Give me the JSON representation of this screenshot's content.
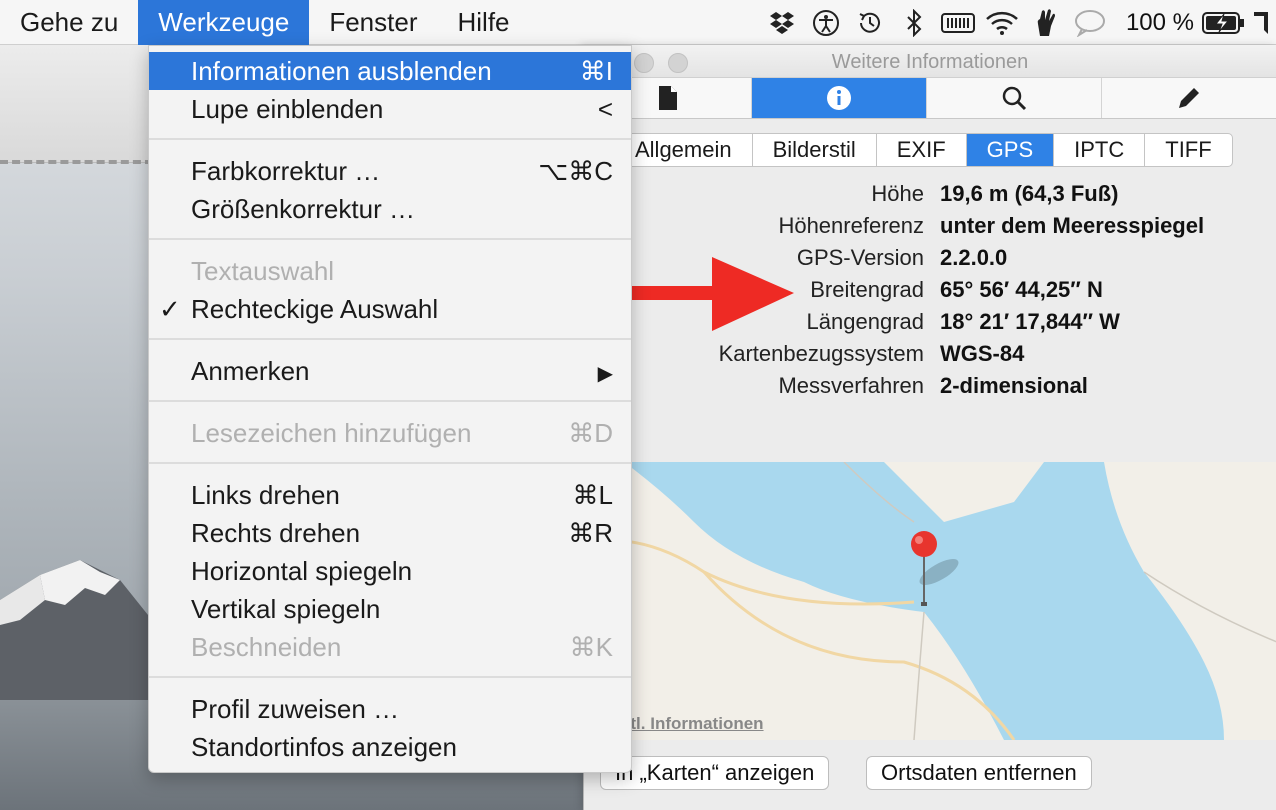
{
  "menubar": {
    "items": [
      "Gehe zu",
      "Werkzeuge",
      "Fenster",
      "Hilfe"
    ],
    "active_index": 1,
    "battery_text": "100 %"
  },
  "status_icons": [
    "dropbox-icon",
    "accessibility-icon",
    "time-machine-icon",
    "bluetooth-icon",
    "memory-icon",
    "wifi-icon",
    "hand-icon",
    "messages-icon",
    "battery-charging-icon"
  ],
  "dropdown": {
    "items": [
      {
        "label": "Informationen ausblenden",
        "shortcut": "⌘I",
        "state": "highlight"
      },
      {
        "label": "Lupe einblenden",
        "shortcut": "<",
        "state": "normal"
      },
      {
        "label": "Farbkorrektur …",
        "shortcut": "⌥⌘C",
        "state": "normal"
      },
      {
        "label": "Größenkorrektur …",
        "shortcut": "",
        "state": "normal"
      },
      {
        "label": "Textauswahl",
        "shortcut": "",
        "state": "disabled"
      },
      {
        "label": "Rechteckige Auswahl",
        "shortcut": "",
        "state": "checked"
      },
      {
        "label": "Anmerken",
        "shortcut": "▶",
        "state": "normal"
      },
      {
        "label": "Lesezeichen hinzufügen",
        "shortcut": "⌘D",
        "state": "disabled"
      },
      {
        "label": "Links drehen",
        "shortcut": "⌘L",
        "state": "normal"
      },
      {
        "label": "Rechts drehen",
        "shortcut": "⌘R",
        "state": "normal"
      },
      {
        "label": "Horizontal spiegeln",
        "shortcut": "",
        "state": "normal"
      },
      {
        "label": "Vertikal spiegeln",
        "shortcut": "",
        "state": "normal"
      },
      {
        "label": "Beschneiden",
        "shortcut": "⌘K",
        "state": "disabled"
      },
      {
        "label": "Profil zuweisen …",
        "shortcut": "",
        "state": "normal"
      },
      {
        "label": "Standortinfos anzeigen",
        "shortcut": "",
        "state": "normal"
      }
    ],
    "check_mark": "✓"
  },
  "info_window": {
    "title": "Weitere Informationen",
    "toolbar_icons": [
      "document-icon",
      "info-icon",
      "magnifier-icon",
      "pencil-icon"
    ],
    "active_toolbar": 1,
    "tabs": [
      "Allgemein",
      "Bilderstil",
      "EXIF",
      "GPS",
      "IPTC",
      "TIFF"
    ],
    "active_tab": 3,
    "gps": [
      {
        "key": "Höhe",
        "value": "19,6 m (64,3 Fuß)"
      },
      {
        "key": "Höhenreferenz",
        "value": "unter dem Meeresspiegel"
      },
      {
        "key": "GPS-Version",
        "value": "2.2.0.0"
      },
      {
        "key": "Breitengrad",
        "value": "65° 56′ 44,25″ N"
      },
      {
        "key": "Längengrad",
        "value": "18° 21′ 17,844″ W"
      },
      {
        "key": "Kartenbezugssystem",
        "value": "WGS-84"
      },
      {
        "key": "Messverfahren",
        "value": "2-dimensional"
      }
    ],
    "map_link": "htl. Informationen",
    "btn_maps": "In „Karten“ anzeigen",
    "btn_remove": "Ortsdaten entfernen"
  },
  "colors": {
    "accent": "#2c76d9",
    "arrow": "#ee2a24",
    "water": "#a9d8ee",
    "pin": "#e8352e"
  }
}
